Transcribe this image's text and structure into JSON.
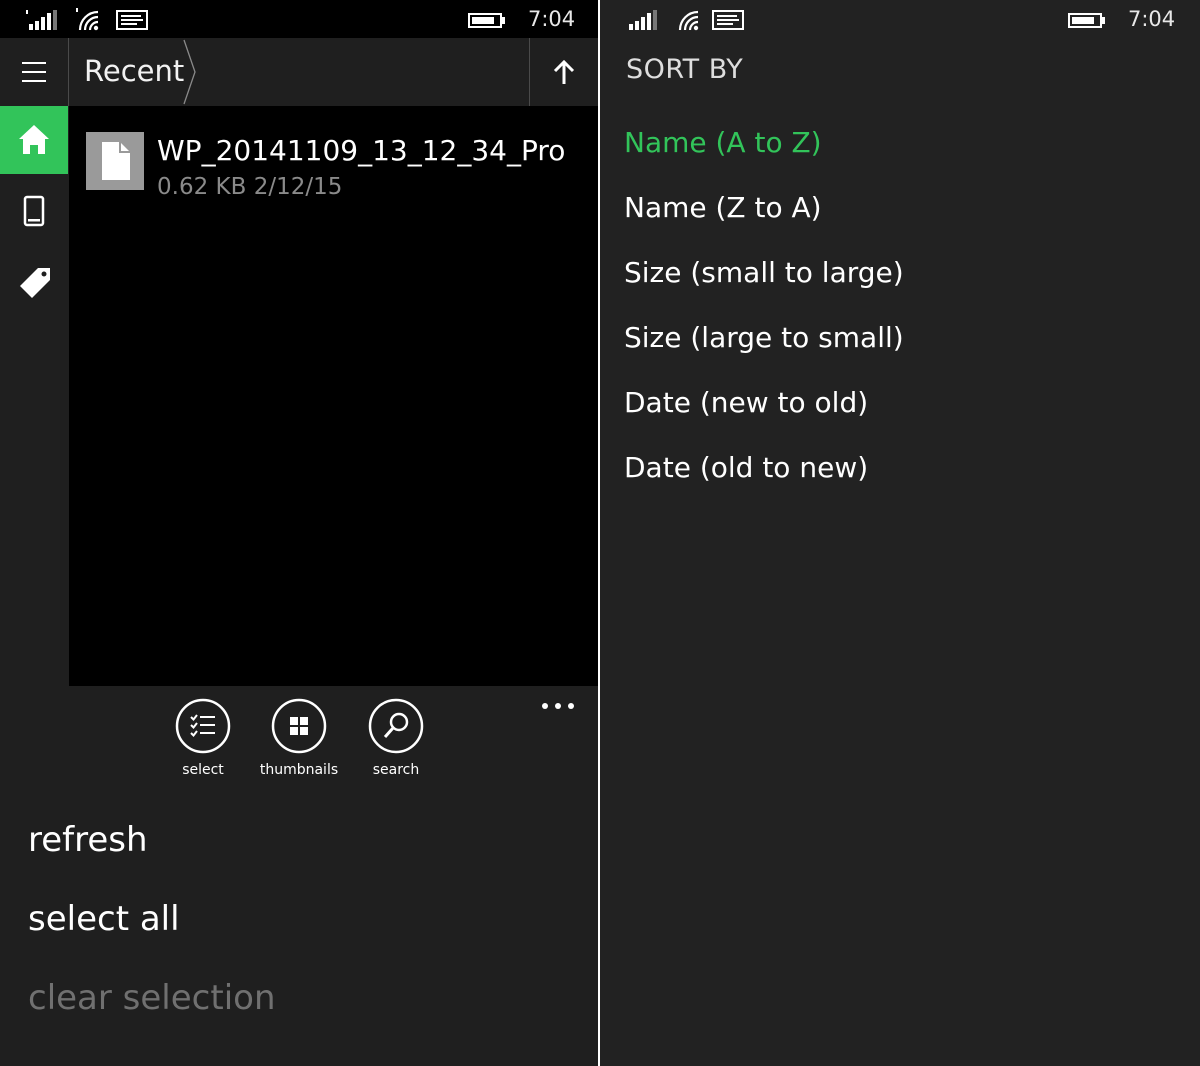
{
  "left_screen": {
    "status_bar": {
      "time": "7:04"
    },
    "header": {
      "breadcrumb": "Recent"
    },
    "files": [
      {
        "name": "WP_20141109_13_12_34_Pro",
        "size": "0.62 KB",
        "date": "2/12/15",
        "icon": "document-icon"
      }
    ],
    "app_bar": {
      "buttons": [
        {
          "label": "select",
          "icon": "checklist-icon"
        },
        {
          "label": "thumbnails",
          "icon": "grid-icon"
        },
        {
          "label": "search",
          "icon": "search-icon"
        }
      ],
      "menu_items": [
        {
          "label": "refresh",
          "enabled": true
        },
        {
          "label": "select all",
          "enabled": true
        },
        {
          "label": "clear selection",
          "enabled": false
        }
      ]
    }
  },
  "right_screen": {
    "status_bar": {
      "time": "7:04"
    },
    "title": "SORT BY",
    "options": [
      {
        "label": "Name (A to Z)",
        "selected": true
      },
      {
        "label": "Name (Z to A)",
        "selected": false
      },
      {
        "label": "Size (small to large)",
        "selected": false
      },
      {
        "label": "Size (large to small)",
        "selected": false
      },
      {
        "label": "Date (new to old)",
        "selected": false
      },
      {
        "label": "Date (old to new)",
        "selected": false
      }
    ]
  },
  "colors": {
    "accent": "#32c45a",
    "background": "#1f1f1f",
    "list_background": "#000000",
    "disabled_text": "#707070"
  }
}
